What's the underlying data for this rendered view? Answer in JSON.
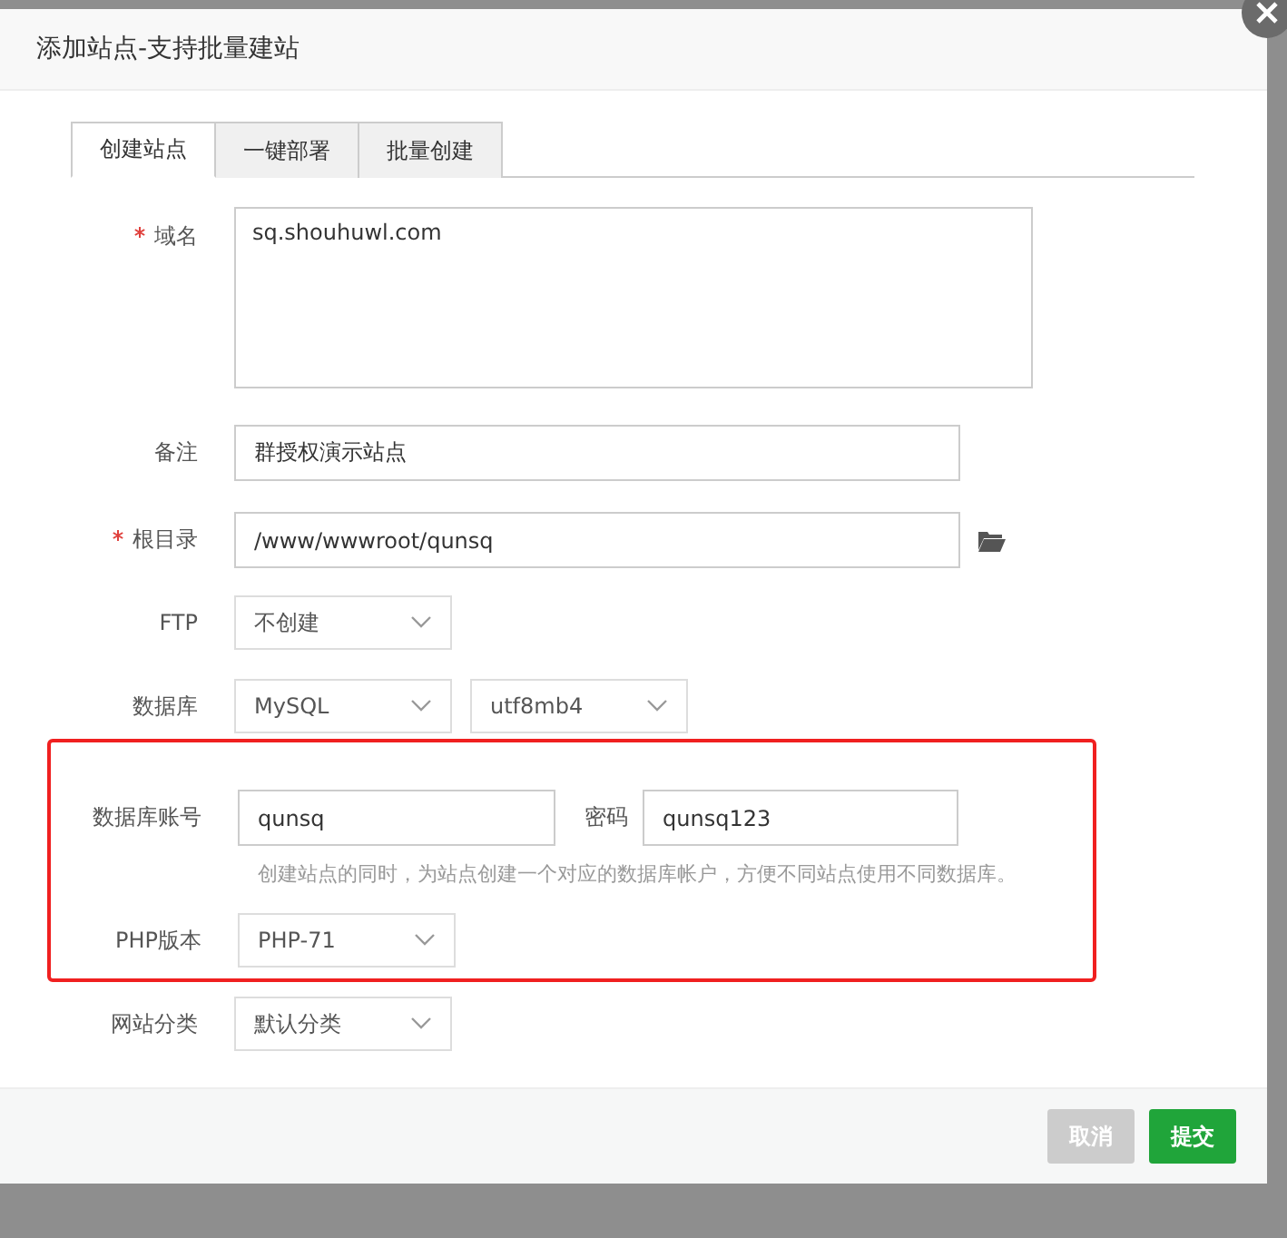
{
  "dialog": {
    "title": "添加站点-支持批量建站",
    "tabs": [
      {
        "label": "创建站点",
        "selected": true
      },
      {
        "label": "一键部署",
        "selected": false
      },
      {
        "label": "批量创建",
        "selected": false
      }
    ],
    "fields": [
      {
        "kind": "textarea",
        "label": "域名",
        "required": true,
        "value": "sq.shouhuwl.com"
      },
      {
        "kind": "text",
        "label": "备注",
        "required": false,
        "value": "群授权演示站点"
      },
      {
        "kind": "path",
        "label": "根目录",
        "required": true,
        "value": "/www/wwwroot/qunsq"
      },
      {
        "kind": "select",
        "label": "FTP",
        "required": false,
        "value": "不创建"
      },
      {
        "kind": "select2",
        "label": "数据库",
        "required": false,
        "value": "MySQL",
        "value2": "utf8mb4"
      }
    ],
    "highlighted": {
      "account_label": "数据库账号",
      "account": "qunsq",
      "password_label": "密码",
      "password": "qunsq123",
      "hint": "创建站点的同时，为站点创建一个对应的数据库帐户，方便不同站点使用不同数据库。",
      "php_label": "PHP版本",
      "php": "PHP-71"
    },
    "category": {
      "label": "网站分类",
      "value": "默认分类"
    },
    "buttons": [
      {
        "label": "取消",
        "kind": "cancel"
      },
      {
        "label": "提交",
        "kind": "submit"
      }
    ]
  }
}
